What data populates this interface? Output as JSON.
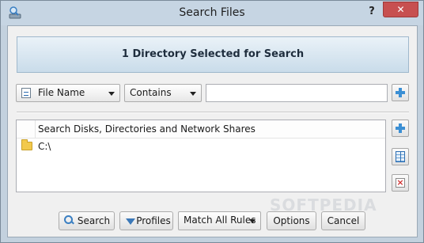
{
  "window": {
    "title": "Search Files",
    "help_label": "?",
    "close_label": "✕"
  },
  "banner": {
    "text": "1 Directory Selected for Search"
  },
  "filter": {
    "field_value": "File Name",
    "operator_value": "Contains",
    "search_value": ""
  },
  "directory_list": {
    "header": "Search Disks, Directories and Network Shares",
    "items": [
      {
        "path": "C:\\",
        "icon": "folder-icon"
      }
    ]
  },
  "footer": {
    "search_label": "Search",
    "profiles_label": "Profiles",
    "match_value": "Match All Rules",
    "options_label": "Options",
    "cancel_label": "Cancel"
  },
  "watermark": "SOFTPEDIA",
  "colors": {
    "titlebar": "#c6d5e3",
    "close_button": "#c75050",
    "accent_icon": "#3b8fd4",
    "folder": "#f2c94c"
  }
}
